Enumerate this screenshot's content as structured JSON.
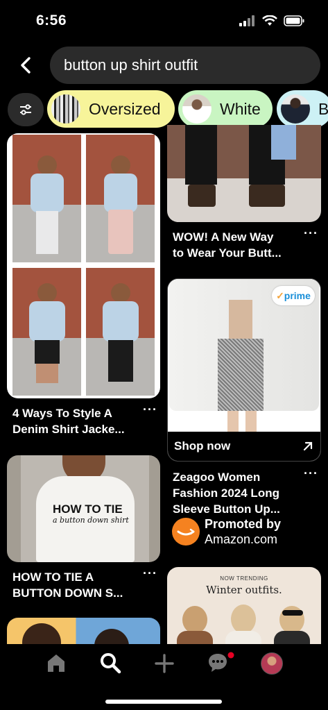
{
  "status": {
    "time": "6:56"
  },
  "search": {
    "query": "button up shirt outfit"
  },
  "chips": [
    {
      "label": "Oversized",
      "color": "#f7f49a"
    },
    {
      "label": "White",
      "color": "#c9f5c2"
    },
    {
      "label": "B",
      "color": "#cdf1f5"
    }
  ],
  "pins": {
    "denim": {
      "title_line1": "4 Ways To Style A",
      "title_line2": "Denim Shirt Jacke..."
    },
    "tie": {
      "title_line1": "HOW TO TIE A",
      "title_line2": "BUTTON DOWN S...",
      "overlay_line1": "HOW TO TIE",
      "overlay_line2": "a button down shirt"
    },
    "wow": {
      "title_line1": "WOW! A New Way",
      "title_line2": "to Wear Your Butt..."
    },
    "amazon": {
      "badge": "prime",
      "cta": "Shop now",
      "title_line1": "Zeagoo Women",
      "title_line2": "Fashion 2024 Long",
      "title_line3": "Sleeve Button Up...",
      "promoted_label": "Promoted by",
      "promoter": "Amazon.com"
    },
    "winter": {
      "kicker": "NOW TRENDING",
      "headline": "Winter outfits."
    }
  },
  "more_menu": "···",
  "colors": {
    "accent_red": "#e60023",
    "search_bg": "#2b2b2b"
  }
}
